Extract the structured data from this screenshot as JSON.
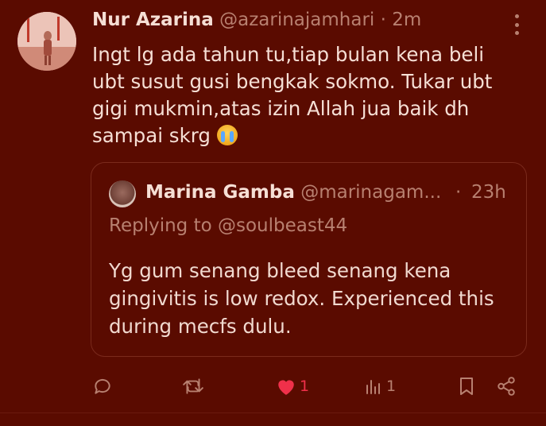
{
  "tweet": {
    "author_name": "Nur Azarina",
    "handle": "@azarinajamhari",
    "separator": "·",
    "time": "2m",
    "text": "Ingt lg ada tahun tu,tiap bulan kena beli ubt susut gusi bengkak sokmo. Tukar ubt gigi mukmin,atas izin Allah jua baik dh sampai skrg",
    "emoji": "loudly-crying-face"
  },
  "quoted": {
    "author_name": "Marina Gamba",
    "handle": "@marinagam...",
    "separator": "·",
    "time": "23h",
    "replying_to": "Replying to @soulbeast44",
    "text": "Yg gum senang bleed senang kena gingivitis is low redox. Experienced this during mecfs dulu."
  },
  "actions": {
    "reply_count": "",
    "retweet_count": "",
    "like_count": "1",
    "views_count": "1"
  },
  "colors": {
    "background": "#5a0b00",
    "text": "#f6dfd5",
    "muted": "#b88070",
    "like": "#f0304a"
  }
}
